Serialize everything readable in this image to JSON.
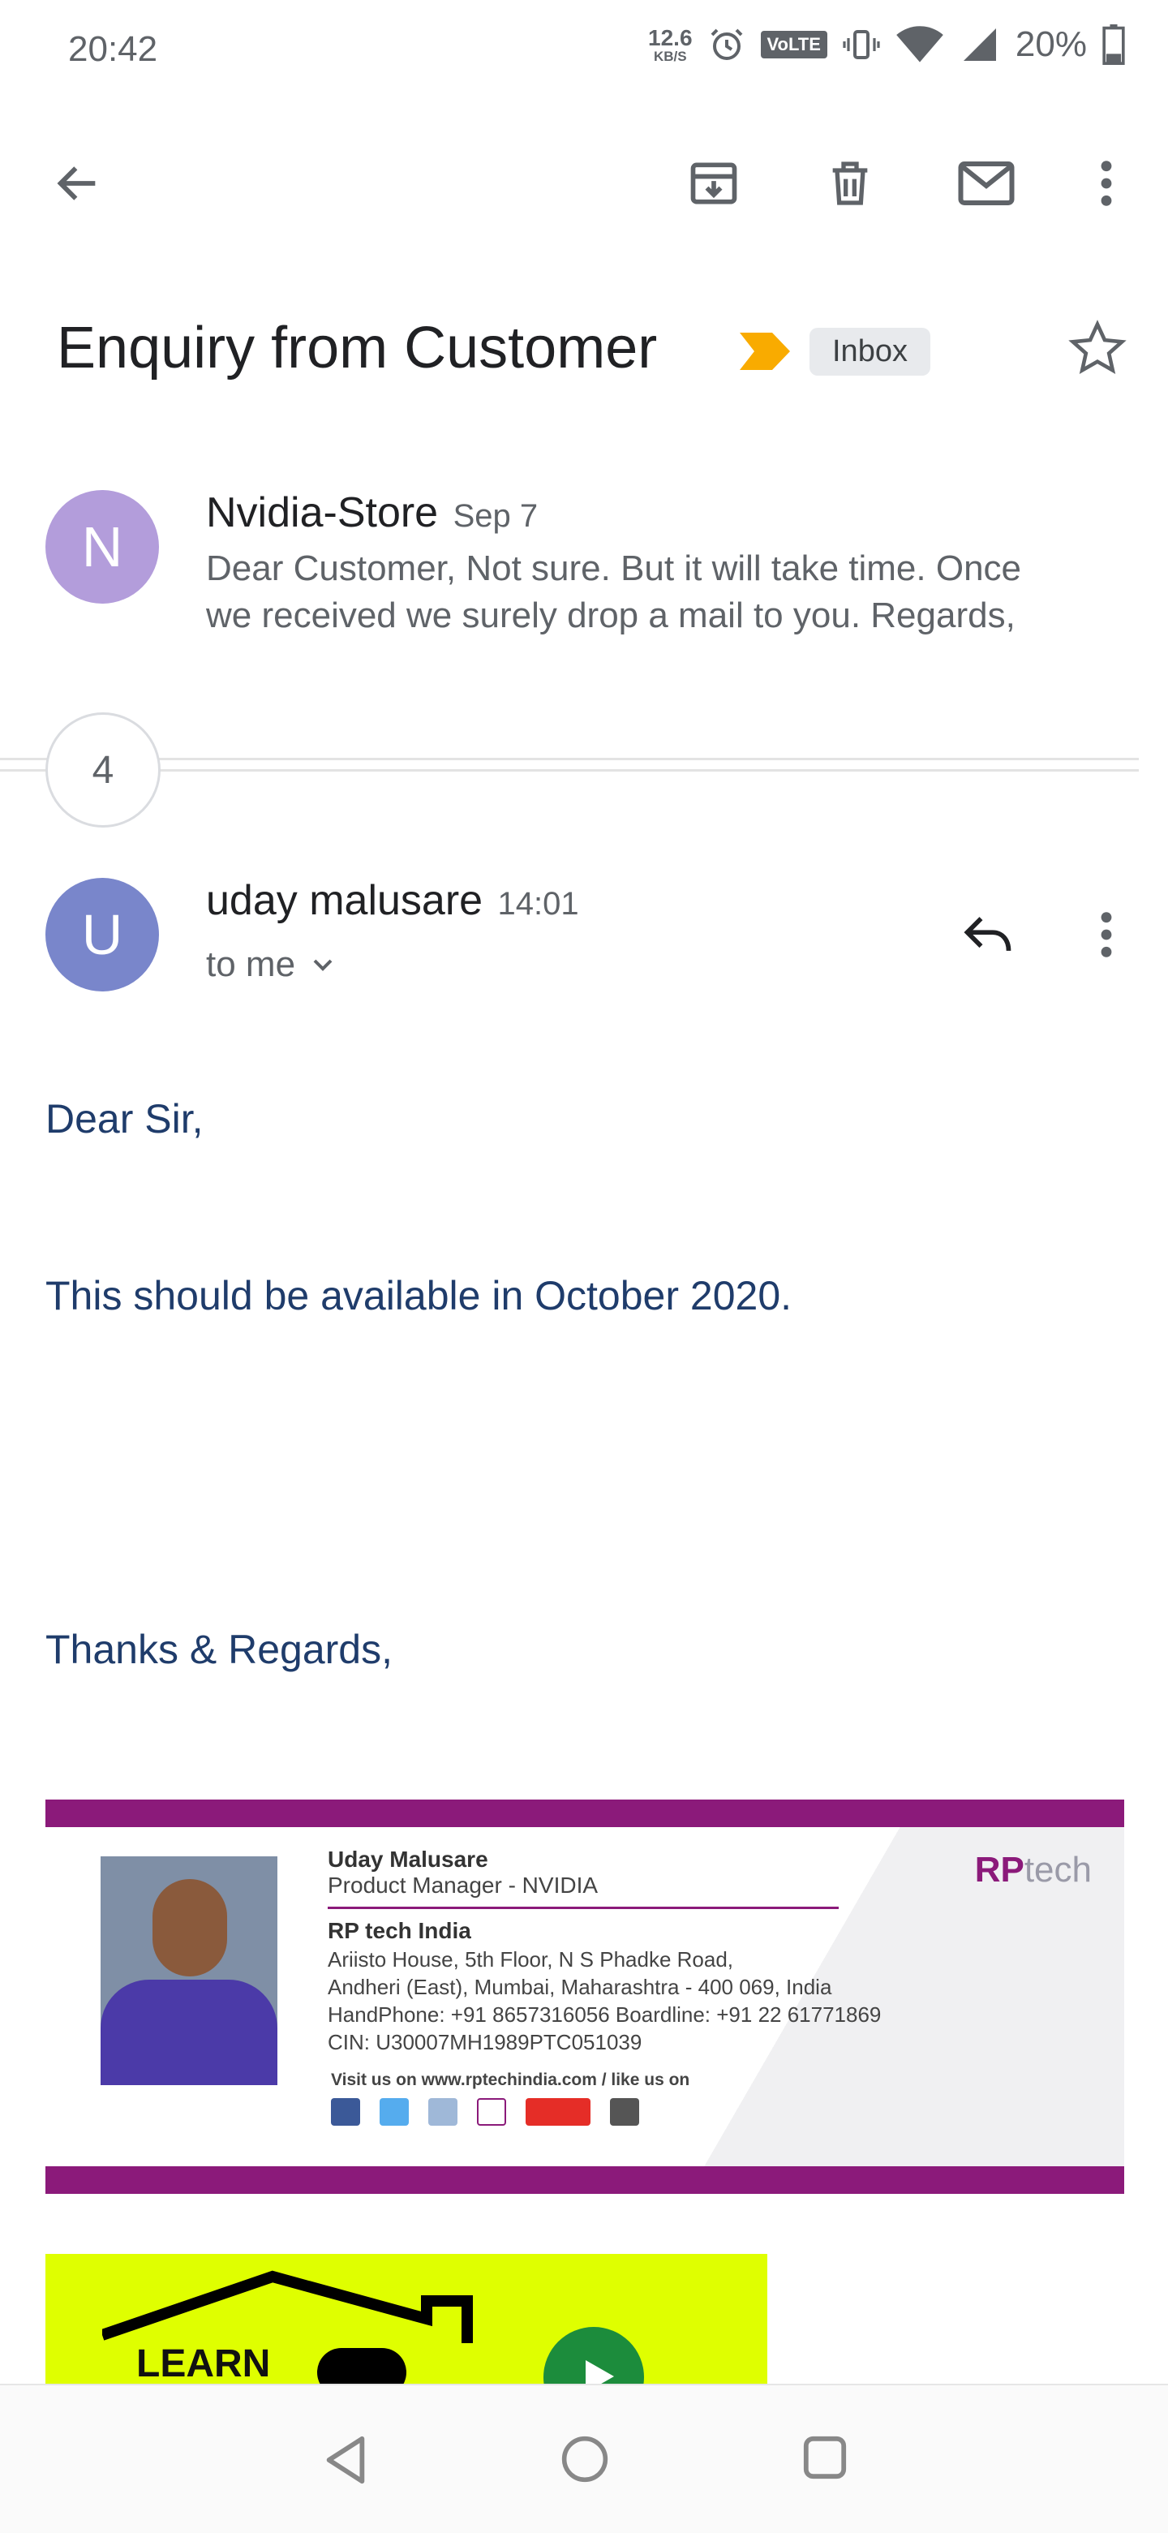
{
  "status_bar": {
    "time": "20:42",
    "net_speed_value": "12.6",
    "net_speed_unit": "KB/S",
    "volte": "VoLTE",
    "battery": "20%",
    "icons": [
      "alarm-icon",
      "vibrate-icon",
      "wifi-icon",
      "signal-icon",
      "battery-icon"
    ]
  },
  "toolbar": {
    "back": "back-arrow-icon",
    "actions": [
      "archive-icon",
      "delete-icon",
      "mark-unread-icon",
      "more-vert-icon"
    ]
  },
  "email": {
    "subject": "Enquiry from Customer",
    "label": "Inbox",
    "important_color": "#f9ab00",
    "starred": false
  },
  "collapsed_message": {
    "avatar_letter": "N",
    "avatar_color": "#b39ddb",
    "sender": "Nvidia-Store",
    "date": "Sep 7",
    "snippet_line1": "Dear Customer, Not sure. But it will take time. Once",
    "snippet_line2": "we received we surely drop a mail to you. Regards,"
  },
  "thread": {
    "hidden_count": "4"
  },
  "open_message": {
    "avatar_letter": "U",
    "avatar_color": "#7986cb",
    "sender": "uday malusare",
    "time": "14:01",
    "recipient": "to me",
    "body": {
      "greeting": "Dear Sir,",
      "line1": "This should be available in October 2020.",
      "closing": "Thanks & Regards,"
    }
  },
  "signature_card": {
    "name": "Uday Malusare",
    "title": "Product Manager - NVIDIA",
    "company": "RP tech India",
    "address1": "Ariisto House, 5th Floor, N S Phadke Road,",
    "address2": "Andheri (East), Mumbai, Maharashtra - 400 069, India",
    "phone": "HandPhone: +91 8657316056 Boardline: +91 22 61771869",
    "cin": "CIN: U30007MH1989PTC051039",
    "social": "Visit us on www.rptechindia.com / like us on",
    "logo_bold": "RP",
    "logo_light": "tech",
    "accent_color": "#8b1a7a"
  },
  "banner": {
    "text": "LEARN",
    "bg_color": "#dfff00"
  },
  "nav_bar": {
    "buttons": [
      "back-triangle-icon",
      "home-circle-icon",
      "recents-square-icon"
    ]
  }
}
